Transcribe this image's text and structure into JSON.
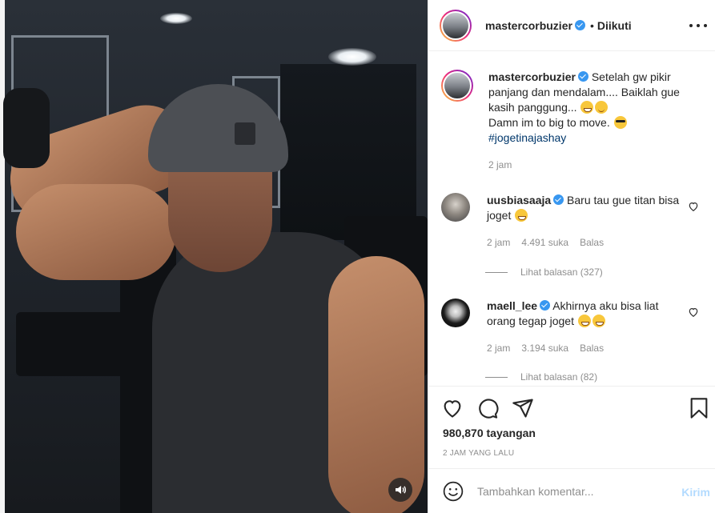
{
  "post": {
    "username": "mastercorbuzier",
    "follow_state": "Diikuti",
    "separator": "•"
  },
  "caption": {
    "username": "mastercorbuzier",
    "text_line1": "Setelah gw pikir panjang dan mendalam.... Baiklah gue kasih panggung...",
    "text_line2": "Damn im to big to move.",
    "hashtag": "#jogetinajashay",
    "time": "2 jam"
  },
  "comments": [
    {
      "username": "uusbiasaaja",
      "text": "Baru tau gue titan bisa joget",
      "time": "2 jam",
      "likes": "4.491 suka",
      "reply_label": "Balas",
      "view_replies": "Lihat balasan (327)"
    },
    {
      "username": "maell_lee",
      "text": "Akhirnya aku bisa liat orang tegap joget",
      "time": "2 jam",
      "likes": "3.194 suka",
      "reply_label": "Balas",
      "view_replies": "Lihat balasan (82)"
    }
  ],
  "stats": {
    "views": "980,870 tayangan",
    "posted": "2 JAM YANG LALU"
  },
  "comment_box": {
    "placeholder": "Tambahkan komentar...",
    "post_label": "Kirim"
  },
  "icons": {
    "like": "heart-icon",
    "comment": "comment-icon",
    "share": "share-icon",
    "save": "bookmark-icon",
    "emoji": "emoji-icon",
    "mute": "speaker-icon",
    "more": "more-icon"
  },
  "colors": {
    "verified": "#3897f0",
    "hashtag": "#00376b",
    "muted_text": "#8e8e8e",
    "post_disabled": "#b3dbff"
  }
}
